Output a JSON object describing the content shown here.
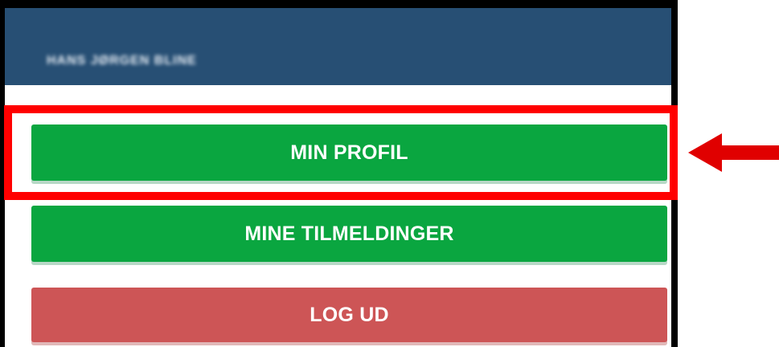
{
  "header": {
    "user_name": "HANS JØRGEN BLINE"
  },
  "menu": {
    "profile_label": "MIN PROFIL",
    "registrations_label": "MINE TILMELDINGER",
    "logout_label": "LOG UD"
  },
  "colors": {
    "header_bg": "#274f74",
    "primary_button": "#0aa640",
    "danger_button": "#cd5556",
    "highlight": "#ff0000"
  },
  "icons": {
    "annotation_arrow": "left-arrow-icon"
  }
}
